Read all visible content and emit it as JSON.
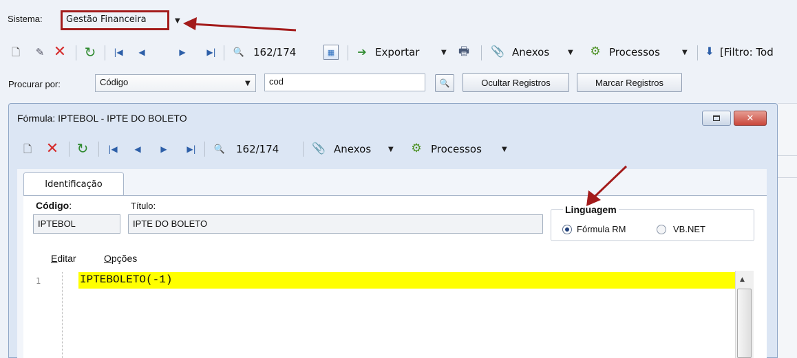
{
  "sistema": {
    "label": "Sistema:",
    "value": "Gestão Financeira"
  },
  "main_toolbar": {
    "record_counter": "162/174",
    "exportar": "Exportar",
    "anexos": "Anexos",
    "processos": "Processos",
    "filtro": "[Filtro: Tod"
  },
  "search": {
    "label": "Procurar por:",
    "field_value": "Código",
    "query": "cod",
    "hide_btn": "Ocultar Registros",
    "mark_btn": "Marcar Registros"
  },
  "formula_window": {
    "title": "Fórmula: IPTEBOL - IPTE DO BOLETO",
    "record_counter": "162/174",
    "anexos": "Anexos",
    "processos": "Processos",
    "tab": "Identificação",
    "codigo_label": "Código",
    "codigo_colon": ":",
    "codigo_value": "IPTEBOL",
    "titulo_label": "Título:",
    "titulo_value": "IPTE DO BOLETO",
    "linguagem_label": "Linguagem",
    "opt_formula": "Fórmula RM",
    "opt_vbnet": "VB.NET",
    "menu_editar_first": "E",
    "menu_editar_rest": "ditar",
    "menu_opcoes_first": "O",
    "menu_opcoes_rest": "pções",
    "editor_line_number": "1",
    "editor_code": "IPTEBOLETO(-1)"
  },
  "colors": {
    "annotation_red": "#a31b1b",
    "highlight_yellow": "#ffff00",
    "window_bg": "#dce6f4",
    "close_red": "#d9534f"
  }
}
